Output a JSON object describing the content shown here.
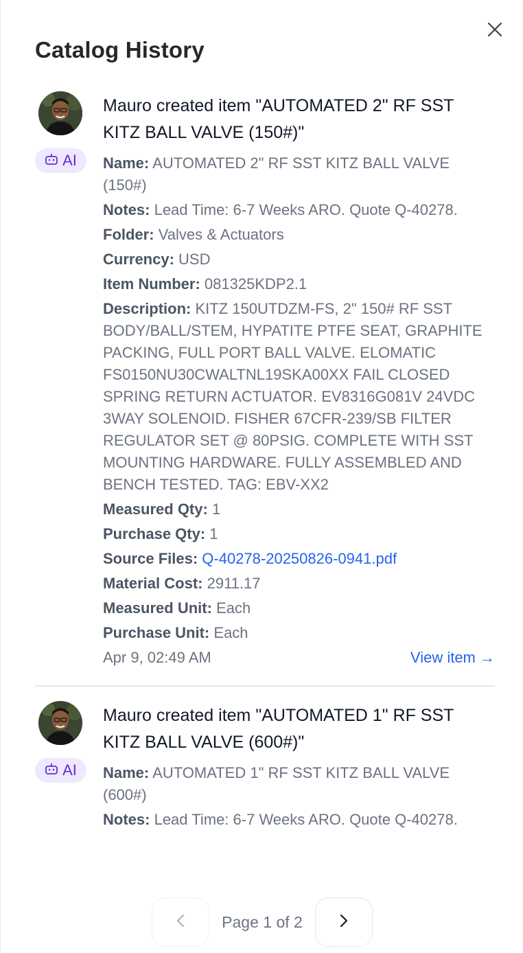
{
  "panel": {
    "title": "Catalog History",
    "close_icon": "close-icon"
  },
  "entries": [
    {
      "user": "Mauro",
      "action": " created item \"AUTOMATED 2\" RF SST KITZ BALL VALVE (150#)\"",
      "badge": "AI",
      "fields": [
        {
          "key": "Name:",
          "value": "AUTOMATED 2\" RF SST KITZ BALL VALVE (150#)"
        },
        {
          "key": "Notes:",
          "value": "Lead Time: 6-7 Weeks ARO. Quote Q-40278."
        },
        {
          "key": "Folder:",
          "value": "Valves & Actuators"
        },
        {
          "key": "Currency:",
          "value": "USD"
        },
        {
          "key": "Item Number:",
          "value": "081325KDP2.1"
        },
        {
          "key": "Description:",
          "value": "KITZ 150UTDZM-FS, 2\" 150# RF SST BODY/BALL/STEM, HYPATITE PTFE SEAT, GRAPHITE PACKING, FULL PORT BALL VALVE. ELOMATIC FS0150NU30CWALTNL19SKA00XX FAIL CLOSED SPRING RETURN ACTUATOR. EV8316G081V 24VDC 3WAY SOLENOID. FISHER 67CFR-239/SB FILTER REGULATOR SET @ 80PSIG. COMPLETE WITH SST MOUNTING HARDWARE. FULLY ASSEMBLED AND BENCH TESTED. TAG: EBV-XX2"
        },
        {
          "key": "Measured Qty:",
          "value": "1"
        },
        {
          "key": "Purchase Qty:",
          "value": "1"
        },
        {
          "key": "Source Files:",
          "value": "Q-40278-20250826-0941.pdf"
        },
        {
          "key": "Material Cost:",
          "value": "2911.17"
        },
        {
          "key": "Measured Unit:",
          "value": "Each"
        },
        {
          "key": "Purchase Unit:",
          "value": "Each"
        }
      ],
      "timestamp": "Apr 9, 02:49 AM",
      "view_label": "View item →"
    },
    {
      "user": "Mauro",
      "action": " created item \"AUTOMATED 1\" RF SST KITZ BALL VALVE (600#)\"",
      "badge": "AI",
      "fields": [
        {
          "key": "Name:",
          "value": "AUTOMATED 1\" RF SST KITZ BALL VALVE (600#)"
        },
        {
          "key": "Notes:",
          "value": "Lead Time: 6-7 Weeks ARO. Quote Q-40278."
        }
      ]
    }
  ],
  "pagination": {
    "label": "Page 1 of 2",
    "prev_icon": "chevron-left-icon",
    "next_icon": "chevron-right-icon"
  },
  "colors": {
    "link": "#2563eb",
    "badge_bg": "#ede9fe",
    "badge_fg": "#6d28d9"
  }
}
